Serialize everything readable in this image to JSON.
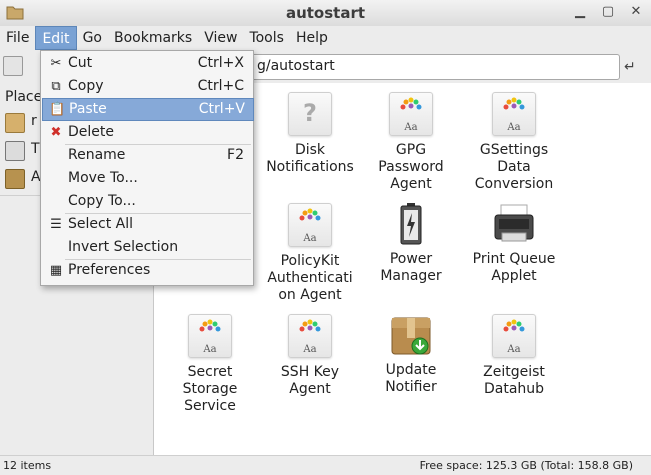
{
  "window": {
    "title": "autostart"
  },
  "menubar": [
    "File",
    "Edit",
    "Go",
    "Bookmarks",
    "View",
    "Tools",
    "Help"
  ],
  "address": {
    "value": "g/autostart"
  },
  "sidebar": {
    "header": "Place",
    "items": [
      {
        "label": "r",
        "icon": "home-icon"
      },
      {
        "label": "T",
        "icon": "trash-icon"
      },
      {
        "label": "A",
        "icon": "applications-icon"
      }
    ]
  },
  "edit_menu": {
    "items": [
      {
        "label": "Cut",
        "accel": "Ctrl+X",
        "icon": "scissors-icon"
      },
      {
        "label": "Copy",
        "accel": "Ctrl+C",
        "icon": "copy-icon"
      },
      {
        "label": "Paste",
        "accel": "Ctrl+V",
        "icon": "paste-icon"
      },
      {
        "label": "Delete",
        "accel": "",
        "icon": "delete-icon"
      },
      {
        "label": "Rename",
        "accel": "F2",
        "icon": ""
      },
      {
        "label": "Move To...",
        "accel": "",
        "icon": ""
      },
      {
        "label": "Copy To...",
        "accel": "",
        "icon": ""
      },
      {
        "label": "Select All",
        "accel": "",
        "icon": "select-all-icon"
      },
      {
        "label": "Invert Selection",
        "accel": "",
        "icon": ""
      },
      {
        "label": "Preferences",
        "accel": "",
        "icon": "preferences-icon"
      }
    ]
  },
  "files": [
    {
      "label": "Disk Notifications",
      "lines": [
        "Disk",
        "Notifications"
      ],
      "icon": "unknown-file-icon"
    },
    {
      "label": "GPG Password Agent",
      "lines": [
        "GPG",
        "Password",
        "Agent"
      ],
      "icon": "font-file-icon"
    },
    {
      "label": "GSettings Data Conversion",
      "lines": [
        "GSettings",
        "Data",
        "Conversion"
      ],
      "icon": "font-file-icon"
    },
    {
      "label": "PolicyKit Authentication Agent",
      "lines": [
        "PolicyKit",
        "Authenticati",
        "on Agent"
      ],
      "icon": "font-file-icon"
    },
    {
      "label": "Power Manager",
      "lines": [
        "Power",
        "Manager"
      ],
      "icon": "battery-icon"
    },
    {
      "label": "Print Queue Applet",
      "lines": [
        "Print Queue",
        "Applet"
      ],
      "icon": "printer-icon"
    },
    {
      "label": "Secret Storage Service",
      "lines": [
        "Secret",
        "Storage",
        "Service"
      ],
      "icon": "font-file-icon"
    },
    {
      "label": "SSH Key Agent",
      "lines": [
        "SSH Key",
        "Agent"
      ],
      "icon": "font-file-icon"
    },
    {
      "label": "Update Notifier",
      "lines": [
        "Update",
        "Notifier"
      ],
      "icon": "package-download-icon"
    },
    {
      "label": "Zeitgeist Datahub",
      "lines": [
        "Zeitgeist",
        "Datahub"
      ],
      "icon": "font-file-icon"
    }
  ],
  "status": {
    "items": "12 items",
    "free_space": "Free space: 125.3 GB (Total: 158.8 GB)"
  },
  "colors": {
    "menu_highlight": "#86a9d8",
    "menubar_active": "#7aa2d4"
  }
}
